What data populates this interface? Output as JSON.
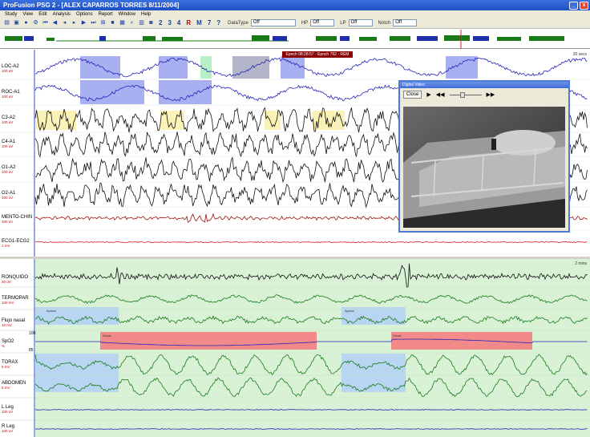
{
  "window": {
    "title": "ProFusion PSG 2 - [ALEX CAPARROS TORRES 8/11/2004]",
    "minimize": "_",
    "close": "x"
  },
  "menu": [
    "Study",
    "View",
    "Edit",
    "Analysis",
    "Options",
    "Report",
    "Window",
    "Help"
  ],
  "toolbar": {
    "montage_numbers": [
      "2",
      "3",
      "4"
    ],
    "r_label": "R",
    "m_label": "M",
    "seven": "7",
    "help_label": "?",
    "data_type_label": "DataType",
    "data_type_value": "Off",
    "hp_label": "HP",
    "hp_value": "Off",
    "lp_label": "LP",
    "lp_value": "Off",
    "notch_label": "Notch",
    "notch_value": "Off"
  },
  "hypnogram": {
    "stage_tag": "Epoch 08:28:57 - Epoch 792 - REM",
    "colors": {
      "stage": "#1a7a1a",
      "rem": "#1f2faa",
      "marker": "#d42020"
    }
  },
  "eeg_channels": [
    {
      "name": "LOC-A2",
      "scale": "100 uV"
    },
    {
      "name": "ROC-A1",
      "scale": "100 uV"
    },
    {
      "name": "C3-A2",
      "scale": "100 uV"
    },
    {
      "name": "C4-A1",
      "scale": "100 uV"
    },
    {
      "name": "O1-A2",
      "scale": "100 uV"
    },
    {
      "name": "O2-A1",
      "scale": "100 uV"
    },
    {
      "name": "MENTO-CHIN",
      "scale": "100 uV"
    },
    {
      "name": "ECG1-ECG2",
      "scale": "1 mV"
    }
  ],
  "eeg_timebase": "30 secs",
  "resp_channels": [
    {
      "name": "RONQUIDO",
      "scale": "20 uV"
    },
    {
      "name": "TERMOPAR",
      "scale": "100 mV"
    },
    {
      "name": "Flujo nasal",
      "scale": "10 mV"
    },
    {
      "name": "SpO2",
      "scale": "%"
    },
    {
      "name": "TORAX",
      "scale": "5 mV"
    },
    {
      "name": "ABDOMEN",
      "scale": "5 mV"
    },
    {
      "name": "L Leg",
      "scale": "100 uV"
    },
    {
      "name": "R Leg",
      "scale": "100 uV"
    }
  ],
  "resp_timebase": "2 mins",
  "spo2_axis": {
    "top": "100",
    "bottom": "85"
  },
  "events": {
    "apnea_label": "Apnea",
    "desat_label": "Desat",
    "colors": {
      "apnea": "#b8d6f2",
      "desat": "#f28a8a",
      "arousal": "#9aa2f0"
    }
  },
  "video": {
    "title": "Digital Video",
    "close_label": "Close",
    "play_icon": "▶",
    "rew_icon": "◀◀",
    "ff_icon": "▶▶",
    "slider_position": 0.4
  }
}
